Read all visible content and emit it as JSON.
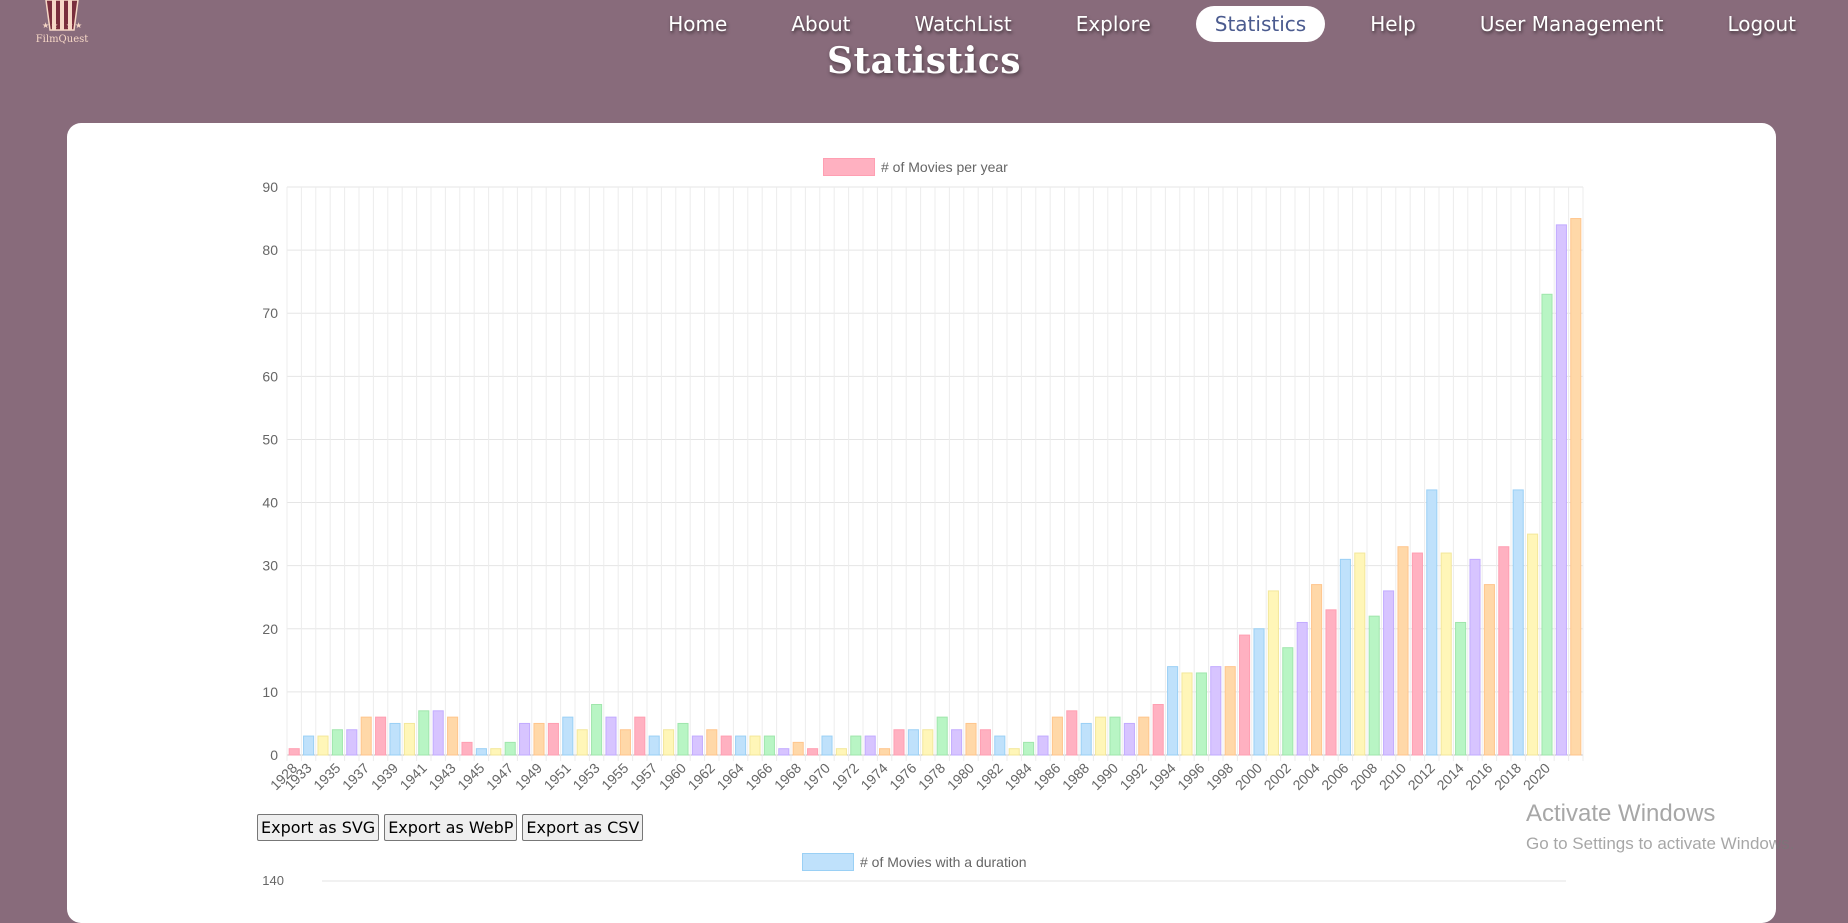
{
  "app": {
    "logo_text": "FilmQuest"
  },
  "nav": {
    "items": [
      {
        "label": "Home",
        "active": false
      },
      {
        "label": "About",
        "active": false
      },
      {
        "label": "WatchList",
        "active": false
      },
      {
        "label": "Explore",
        "active": false
      },
      {
        "label": "Statistics",
        "active": true
      },
      {
        "label": "Help",
        "active": false
      },
      {
        "label": "User Management",
        "active": false
      },
      {
        "label": "Logout",
        "active": false
      }
    ]
  },
  "page": {
    "title": "Statistics"
  },
  "colors": {
    "background": "#886b7b",
    "card": "#ffffff",
    "active_nav_text": "#4b5b8f",
    "bar_palette": [
      "#ffb1c1",
      "#9ad0f5",
      "#ffe6aa",
      "#a5dfdf",
      "#ccb2ff",
      "#ffcf9f"
    ]
  },
  "chart_data": [
    {
      "type": "bar",
      "legend": "# of Movies per year",
      "ylim": [
        0,
        90
      ],
      "yticks": [
        0,
        10,
        20,
        30,
        40,
        50,
        60,
        70,
        80,
        90
      ],
      "grid": true,
      "legend_position": "top",
      "categories": [
        "1928",
        "1933",
        "1934",
        "1935",
        "1936",
        "1937",
        "1938",
        "1939",
        "1940",
        "1941",
        "1942",
        "1943",
        "1944",
        "1945",
        "1946",
        "1947",
        "1948",
        "1949",
        "1950",
        "1951",
        "1952",
        "1953",
        "1954",
        "1955",
        "1956",
        "1957",
        "1958",
        "1960",
        "1961",
        "1962",
        "1963",
        "1964",
        "1965",
        "1966",
        "1967",
        "1968",
        "1969",
        "1970",
        "1971",
        "1972",
        "1973",
        "1974",
        "1975",
        "1976",
        "1977",
        "1978",
        "1979",
        "1980",
        "1981",
        "1982",
        "1983",
        "1984",
        "1985",
        "1986",
        "1987",
        "1988",
        "1989",
        "1990",
        "1991",
        "1992",
        "1993",
        "1994",
        "1995",
        "1996",
        "1997",
        "1998",
        "1999",
        "2000",
        "2001",
        "2002",
        "2003",
        "2004",
        "2005",
        "2006",
        "2007",
        "2008",
        "2009",
        "2010",
        "2011",
        "2012",
        "2013",
        "2014",
        "2015",
        "2016",
        "2017",
        "2018",
        "2019",
        "2020",
        "2021"
      ],
      "tick_labels_shown": [
        "1928",
        "1933",
        "1935",
        "1937",
        "1939",
        "1941",
        "1943",
        "1945",
        "1947",
        "1949",
        "1951",
        "1953",
        "1955",
        "1957",
        "1960",
        "1962",
        "1964",
        "1966",
        "1968",
        "1970",
        "1972",
        "1974",
        "1976",
        "1978",
        "1980",
        "1982",
        "1984",
        "1986",
        "1988",
        "1990",
        "1992",
        "1994",
        "1996",
        "1998",
        "2000",
        "2002",
        "2004",
        "2006",
        "2008",
        "2010",
        "2012",
        "2014",
        "2016",
        "2018",
        "2020"
      ],
      "values": [
        1,
        3,
        3,
        4,
        4,
        6,
        6,
        5,
        5,
        7,
        7,
        6,
        2,
        1,
        1,
        2,
        5,
        5,
        5,
        6,
        4,
        8,
        6,
        4,
        6,
        3,
        4,
        5,
        3,
        4,
        3,
        3,
        3,
        3,
        1,
        2,
        1,
        3,
        1,
        3,
        3,
        1,
        4,
        4,
        4,
        6,
        4,
        5,
        4,
        3,
        1,
        2,
        3,
        6,
        7,
        5,
        6,
        6,
        5,
        6,
        8,
        14,
        13,
        13,
        14,
        14,
        19,
        20,
        26,
        17,
        21,
        27,
        23,
        31,
        32,
        22,
        26,
        33,
        32,
        42,
        32,
        21,
        31,
        27,
        33,
        42,
        35,
        73,
        84,
        85
      ],
      "bar_colors": [
        "#ffb1c1",
        "#9ad0f5",
        "#ffe6aa",
        "#a5dfdf",
        "#ccb2ff",
        "#ffcf9f"
      ]
    },
    {
      "type": "bar",
      "legend": "# of Movies with a duration",
      "ylim": [
        0,
        140
      ],
      "yticks": [
        140
      ]
    }
  ],
  "exports": {
    "svg_label": "Export as SVG",
    "webp_label": "Export as WebP",
    "csv_label": "Export as CSV"
  },
  "watermark": {
    "line1": "Activate Windows",
    "line2": "Go to Settings to activate Windows."
  }
}
